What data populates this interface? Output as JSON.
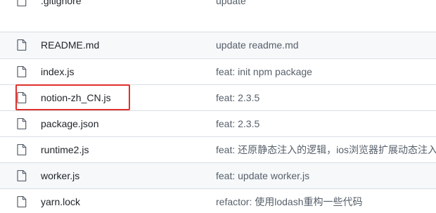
{
  "files": [
    {
      "name": ".gitignore",
      "message": "update",
      "icon": "file-icon"
    },
    {
      "name": "README.md",
      "message": "update readme.md",
      "icon": "file-icon"
    },
    {
      "name": "index.js",
      "message": "feat: init npm package",
      "icon": "file-icon"
    },
    {
      "name": "notion-zh_CN.js",
      "message": "feat: 2.3.5",
      "icon": "file-icon"
    },
    {
      "name": "package.json",
      "message": "feat: 2.3.5",
      "icon": "file-icon"
    },
    {
      "name": "runtime2.js",
      "message": "feat: 还原静态注入的逻辑，ios浏览器扩展动态注入",
      "icon": "file-icon"
    },
    {
      "name": "worker.js",
      "message": "feat: update worker.js",
      "icon": "file-icon"
    },
    {
      "name": "yarn.lock",
      "message": "refactor: 使用lodash重构一些代码",
      "icon": "file-icon"
    }
  ],
  "highlight": {
    "file": "notion-zh_CN.js",
    "color": "#e0302d"
  },
  "colors": {
    "row_border": "#d8dee4",
    "shaded_row": "#f6f8fa",
    "message_text": "#57606a"
  }
}
